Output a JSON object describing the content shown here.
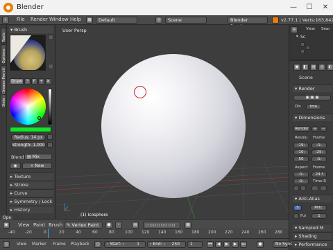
{
  "window": {
    "title": "Blender",
    "minimize": "—",
    "maximize": "☐",
    "close": "✕"
  },
  "top_menu": {
    "file": "File",
    "render": "Render",
    "window": "Window",
    "help": "Help",
    "layout": "Default",
    "scene": "Scene",
    "engine": "Blender Render",
    "stats": "v2.77.1 | Verts:163,842 | F"
  },
  "left_tabs": [
    "Tools",
    "Options",
    "Grease Pencil",
    "Slots"
  ],
  "tool_panel": {
    "brush_header": "Brush",
    "draw_label": "Draw",
    "brush_users": "3",
    "brush_fake": "F",
    "radius": "Radius:  14 px",
    "strength": "Strength: 1.000",
    "blend_label": "Blend",
    "blend_value": "Mix",
    "new_button": "New",
    "sections": [
      "Texture",
      "Stroke",
      "Curve",
      "Symmetry / Lock",
      "History"
    ]
  },
  "viewport": {
    "view_label": "User Persp",
    "object_label": "(1) Icosphere"
  },
  "right_panel": {
    "outliner_tabs": [
      "View",
      "Sear"
    ],
    "outliner_items": [
      "Sc"
    ],
    "scene_label": "Scene",
    "render_header": "Render",
    "dis_label": "Dis",
    "dis_value": "Ima",
    "dimensions_header": "Dimensions",
    "render_preset": "Render",
    "resolution_label": "Resolu",
    "frame_label": "Frame",
    "res_x": "19",
    "res_y": "10",
    "res_pct": "50",
    "frame_start": "1",
    "frame_end": "25",
    "frame_step": "1",
    "aspect_label": "Aspect",
    "frame_rate_label": "Frame",
    "aspect_x": "1",
    "aspect_y": "1",
    "frame_rate": "24 f",
    "time_label": "Time R",
    "anti_alias_header": "Anti-Alias",
    "aa_samples": "5",
    "aa_filter": "Mitc",
    "full_label": "Ful",
    "full_value": "1",
    "sampled_header": "Sampled M",
    "shading_header": "Shading",
    "performance_header": "Performance"
  },
  "bottom_header": {
    "mode_menu_label": "Ope",
    "view": "View",
    "paint": "Paint",
    "brush": "Brush",
    "mode": "Vertex Paint"
  },
  "timeline": {
    "ticks": [
      "-40",
      "-20",
      "0",
      "20",
      "40",
      "60",
      "80",
      "100",
      "120",
      "140",
      "160",
      "180",
      "200",
      "220",
      "240",
      "260",
      "280"
    ],
    "view": "View",
    "marker": "Marker",
    "frame": "Frame",
    "playback": "Playback",
    "start": "Start:",
    "start_value": "1",
    "end": "End:",
    "end_value": "250",
    "current": "1",
    "sync": "No Sync"
  }
}
